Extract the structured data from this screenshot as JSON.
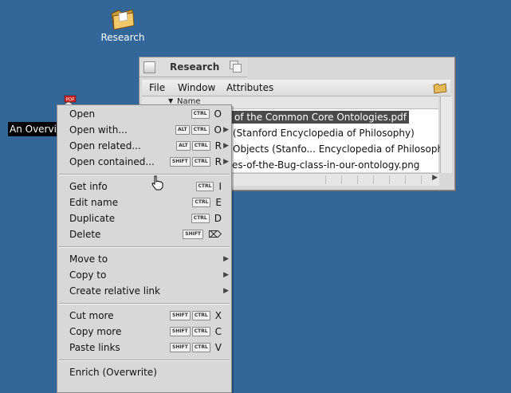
{
  "desktop": {
    "folder_icon_label": "Research",
    "selected_file_label": "An Overview of the Common Core Ontologies.pdf",
    "pdf_badge": "PDF"
  },
  "window": {
    "title": "Research",
    "menu": {
      "file": "File",
      "window": "Window",
      "attributes": "Attributes"
    },
    "column_name": "Name",
    "rows": [
      {
        "text": "of the Common Core Ontologies.pdf",
        "selected": true
      },
      {
        "text": "(Stanford Encyclopedia of Philosophy)",
        "selected": false
      },
      {
        "text": "Objects (Stanfo... Encyclopedia of Philosophy)",
        "selected": false
      },
      {
        "text": "es-of-the-Bug-class-in-our-ontology.png",
        "selected": false
      }
    ]
  },
  "context_menu": {
    "items": [
      {
        "label": "Open",
        "keys": [
          "CTRL"
        ],
        "letter": "O"
      },
      {
        "label": "Open with...",
        "keys": [
          "ALT",
          "CTRL"
        ],
        "letter": "O",
        "submenu": true
      },
      {
        "label": "Open related...",
        "keys": [
          "ALT",
          "CTRL"
        ],
        "letter": "R",
        "submenu": true
      },
      {
        "label": "Open contained...",
        "keys": [
          "SHIFT",
          "CTRL"
        ],
        "letter": "R",
        "submenu": true
      },
      {
        "label": "Get info",
        "keys": [
          "CTRL"
        ],
        "letter": "I"
      },
      {
        "label": "Edit name",
        "keys": [
          "CTRL"
        ],
        "letter": "E"
      },
      {
        "label": "Duplicate",
        "keys": [
          "CTRL"
        ],
        "letter": "D"
      },
      {
        "label": "Delete",
        "keys": [
          "SHIFT"
        ],
        "letter": "⌦"
      },
      {
        "label": "Move to",
        "submenu": true
      },
      {
        "label": "Copy to",
        "submenu": true
      },
      {
        "label": "Create relative link",
        "submenu": true
      },
      {
        "label": "Cut more",
        "keys": [
          "SHIFT",
          "CTRL"
        ],
        "letter": "X"
      },
      {
        "label": "Copy more",
        "keys": [
          "SHIFT",
          "CTRL"
        ],
        "letter": "C"
      },
      {
        "label": "Paste links",
        "keys": [
          "SHIFT",
          "CTRL"
        ],
        "letter": "V"
      },
      {
        "label": "Enrich (Overwrite)"
      }
    ]
  },
  "colors": {
    "desktop": "#336699",
    "menu_bg": "#d8d8d8",
    "selection": "#000000"
  }
}
